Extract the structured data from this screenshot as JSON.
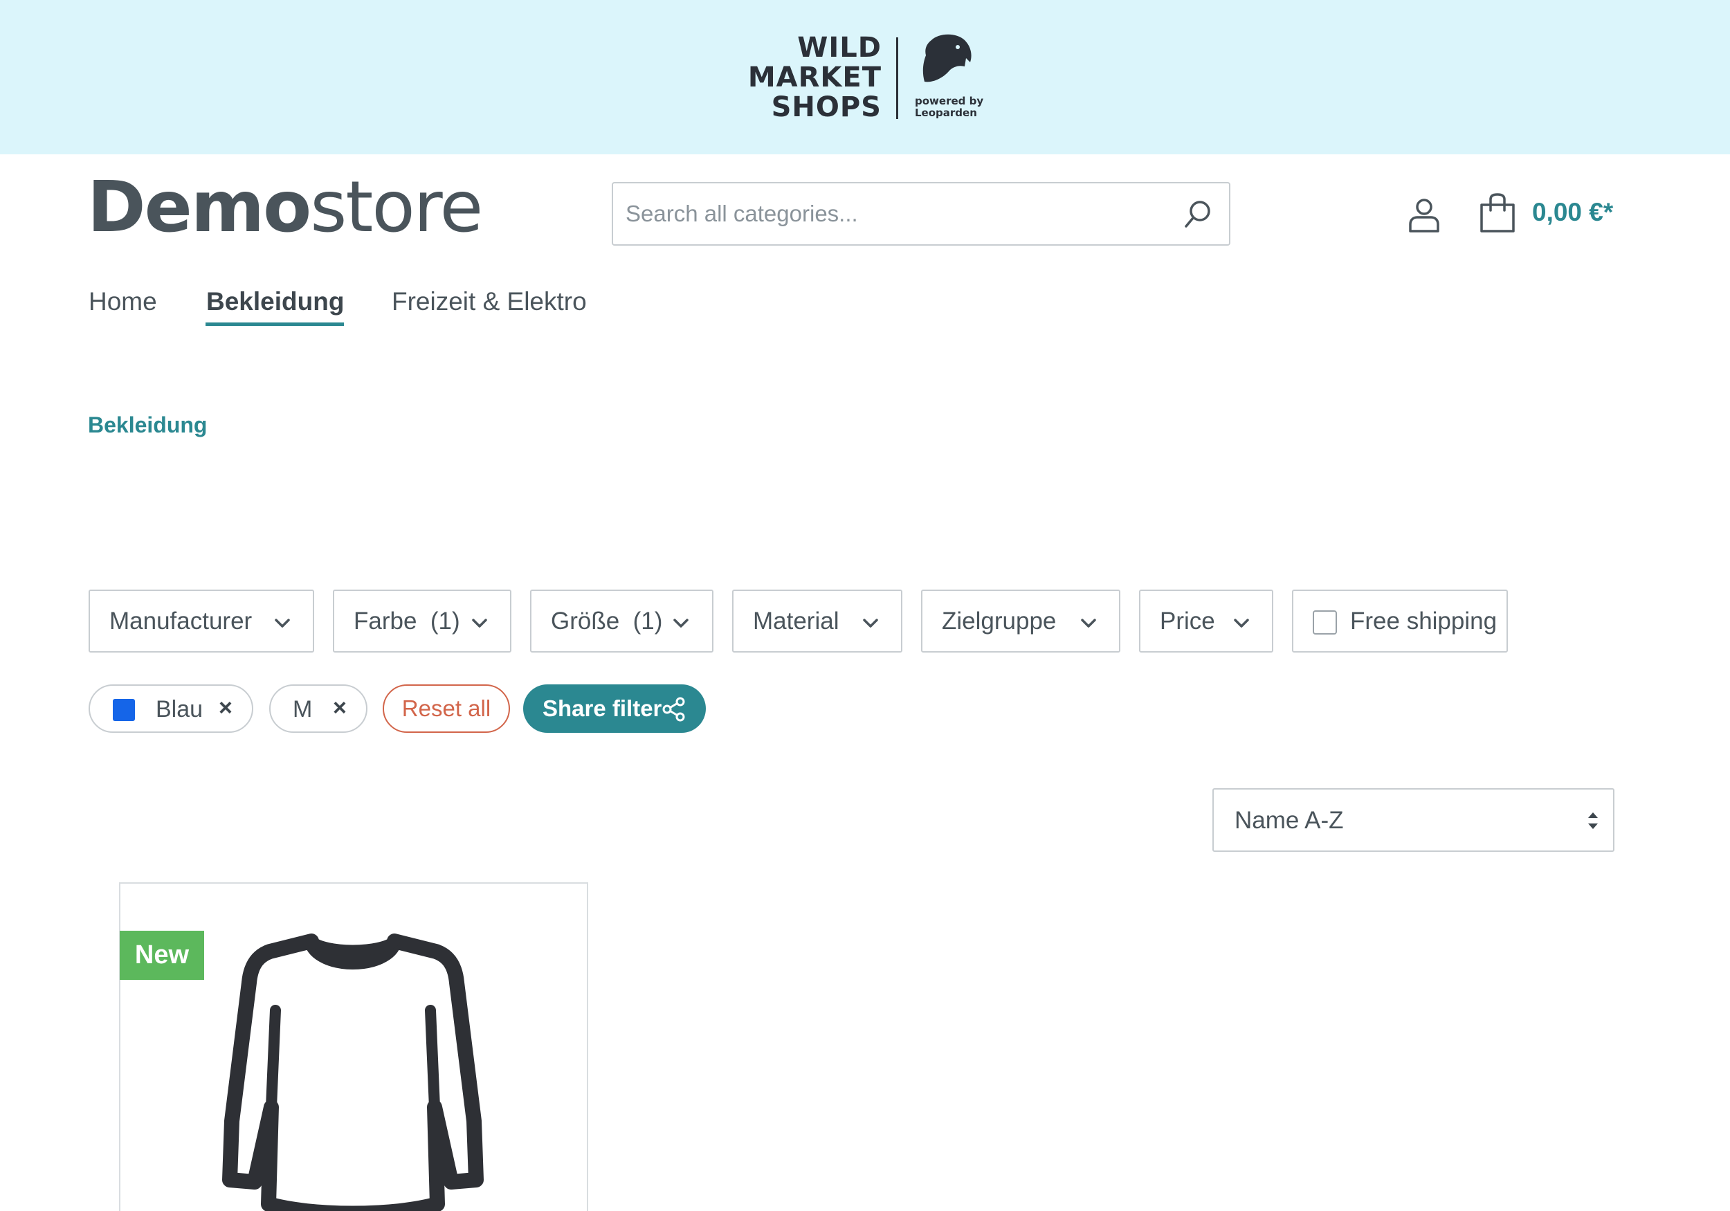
{
  "banner": {
    "brand_lines": [
      "WILD",
      "MARKET",
      "SHOPS"
    ],
    "powered_lines": [
      "powered by",
      "Leoparden"
    ],
    "brand_icon": "leopard-head-icon"
  },
  "header": {
    "logo_bold": "Demo",
    "logo_light": "store",
    "search_placeholder": "Search all categories...",
    "cart_total": "0,00 €*",
    "icons": [
      "search-icon",
      "account-icon",
      "cart-icon"
    ]
  },
  "nav": {
    "items": [
      {
        "label": "Home",
        "active": false
      },
      {
        "label": "Bekleidung",
        "active": true
      },
      {
        "label": "Freizeit & Elektro",
        "active": false
      }
    ]
  },
  "breadcrumb": "Bekleidung",
  "filters": [
    {
      "label": "Manufacturer"
    },
    {
      "label": "Farbe  (1)"
    },
    {
      "label": "Größe  (1)"
    },
    {
      "label": "Material"
    },
    {
      "label": "Zielgruppe"
    },
    {
      "label": "Price"
    },
    {
      "label": "Free shipping",
      "checked": false
    }
  ],
  "active_filters": [
    {
      "label": "Blau",
      "swatch_color": "#1565e8"
    },
    {
      "label": "M"
    }
  ],
  "reset_label": "Reset all",
  "share_label": "Share filter",
  "sorting": {
    "value": "Name A-Z"
  },
  "product": {
    "badge": "New",
    "image": "long-sleeve-shirt-icon"
  },
  "colors": {
    "accent": "#2b8891",
    "banner_bg": "#dbf5fb",
    "badge_new": "#5cb85c",
    "reset": "#d2654a"
  }
}
